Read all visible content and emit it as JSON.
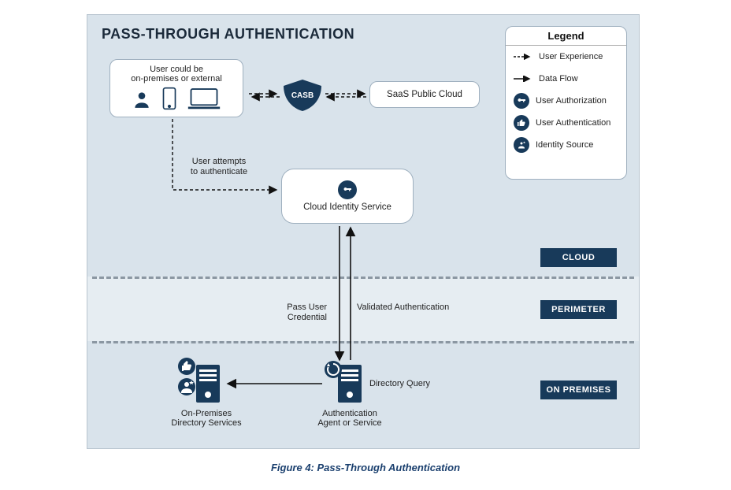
{
  "title": "PASS-THROUGH AUTHENTICATION",
  "caption": "Figure 4: Pass-Through Authentication",
  "legend": {
    "title": "Legend",
    "items": {
      "ux": "User Experience",
      "df": "Data Flow",
      "authz": "User Authorization",
      "authn": "User Authentication",
      "idsrc": "Identity Source"
    }
  },
  "regions": {
    "cloud": "CLOUD",
    "perimeter": "PERIMETER",
    "onprem": "ON PREMISES"
  },
  "nodes": {
    "user_title_line1": "User could be",
    "user_title_line2": "on-premises or external",
    "casb": "CASB",
    "saas": "SaaS Public Cloud",
    "cis": "Cloud Identity Service",
    "auth_agent_line1": "Authentication",
    "auth_agent_line2": "Agent or Service",
    "onprem_dir_line1": "On-Premises",
    "onprem_dir_line2": "Directory Services"
  },
  "edges": {
    "user_attempt_line1": "User attempts",
    "user_attempt_line2": "to authenticate",
    "pass_cred": "Pass User Credential",
    "valid_auth": "Validated Authentication",
    "dir_query": "Directory Query"
  },
  "colors": {
    "navy": "#183a5a",
    "panel": "#d9e3eb",
    "perimeter": "#e6edf2"
  }
}
